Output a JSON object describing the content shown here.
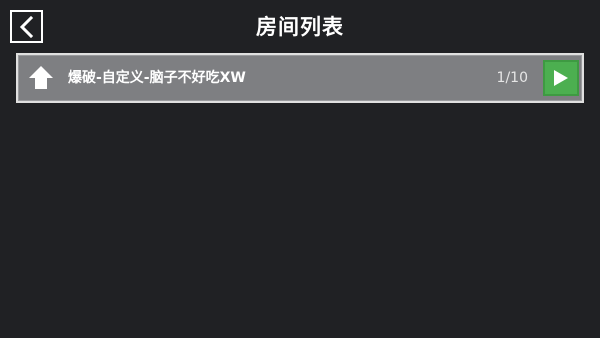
{
  "header": {
    "title": "房间列表",
    "back_icon": "chevron-left-icon"
  },
  "rooms": [
    {
      "icon": "home-icon",
      "name": "爆破-自定义-脑子不好吃XW",
      "player_count": "1/10",
      "join_icon": "play-icon"
    }
  ],
  "colors": {
    "background": "#202124",
    "row_background": "#7e7f82",
    "row_border": "#e0e0e0",
    "join_button": "#4caf50",
    "text": "#ffffff"
  }
}
